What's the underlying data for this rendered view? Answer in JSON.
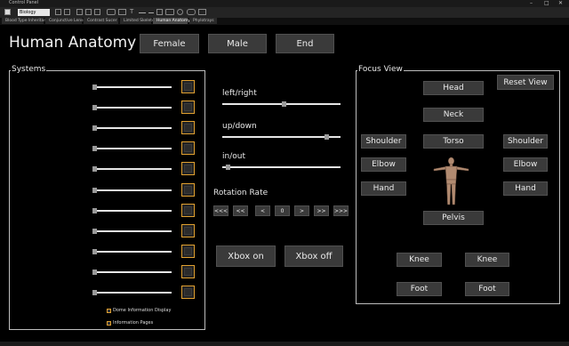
{
  "window": {
    "title": "Control Panel",
    "controls": [
      "–",
      "□",
      "✕"
    ]
  },
  "toolbar": {
    "dropdown_value": "Biology"
  },
  "tabs": [
    "Blood Type Inheritance",
    "Conjunctive Lenses",
    "Contrast Sucer",
    "Limited Skeleton",
    "Human Anatomy",
    "Phylotrays"
  ],
  "active_tab": 4,
  "app": {
    "title": "Human Anatomy"
  },
  "header_buttons": {
    "female": "Female",
    "male": "Male",
    "end": "End"
  },
  "systems": {
    "label": "Systems",
    "slider_count": 11
  },
  "info_options": {
    "dome": "Dome Information Display",
    "pages": "Information Pages"
  },
  "view_sliders": [
    {
      "label": "left/right",
      "value": 0.52
    },
    {
      "label": "up/down",
      "value": 0.9
    },
    {
      "label": "in/out",
      "value": 0.03
    }
  ],
  "rotation": {
    "label": "Rotation Rate",
    "buttons": [
      "<<<",
      "<<",
      "<",
      "0",
      ">",
      ">>",
      ">>>"
    ]
  },
  "xbox": {
    "on": "Xbox on",
    "off": "Xbox off"
  },
  "focus": {
    "label": "Focus View",
    "reset": "Reset View",
    "head": "Head",
    "neck": "Neck",
    "shoulder_left": "Shoulder",
    "torso": "Torso",
    "shoulder_right": "Shoulder",
    "elbow_left": "Elbow",
    "elbow_right": "Elbow",
    "hand_left": "Hand",
    "hand_right": "Hand",
    "pelvis": "Pelvis",
    "knee_left": "Knee",
    "knee_right": "Knee",
    "foot_left": "Foot",
    "foot_right": "Foot"
  },
  "colors": {
    "accent": "#e0a030",
    "button": "#3a3a3a",
    "background": "#000000"
  }
}
